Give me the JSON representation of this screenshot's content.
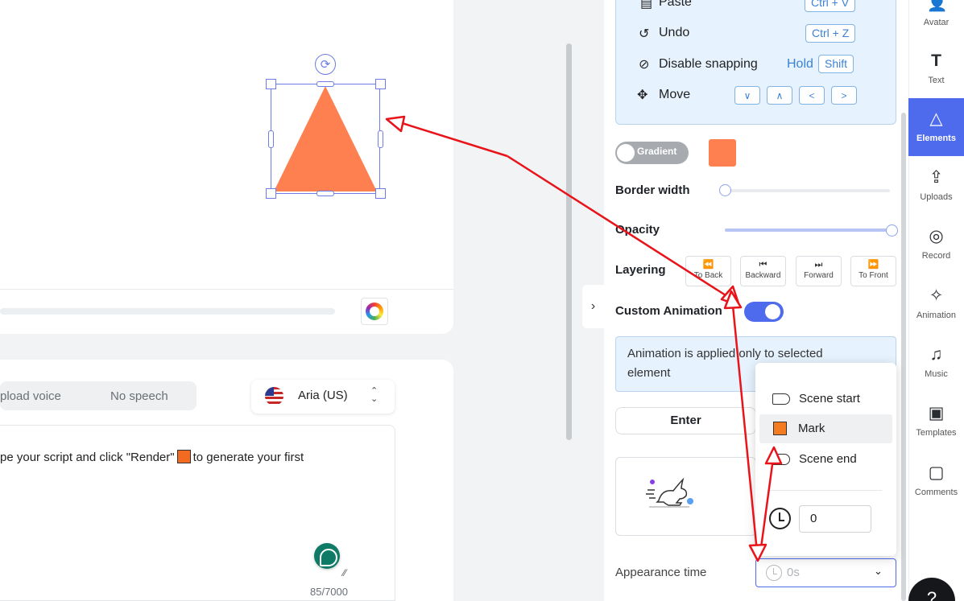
{
  "script": {
    "voice_tabs": [
      "pload voice",
      "No speech"
    ],
    "voice_name": "Aria (US)",
    "text_before": "pe your script and click \"Render\"",
    "text_after": "to generate your first",
    "char_count": "85/7000"
  },
  "shortcuts": {
    "paste": {
      "label": "Paste",
      "key": "Ctrl + V"
    },
    "undo": {
      "label": "Undo",
      "key": "Ctrl + Z"
    },
    "snapping": {
      "label": "Disable snapping",
      "hold": "Hold",
      "key": "Shift"
    },
    "move": {
      "label": "Move"
    }
  },
  "style": {
    "gradient_label": "Gradient",
    "fill_color": "#fe7f4f",
    "border_width_label": "Border width",
    "opacity_label": "Opacity",
    "layering_label": "Layering",
    "layering_buttons": [
      "To Back",
      "Backward",
      "Forward",
      "To Front"
    ]
  },
  "animation": {
    "custom_label": "Custom Animation",
    "info": "Animation is applied only to selected element",
    "enter_tab": "Enter",
    "appearance_label": "Appearance time",
    "appearance_value": "0s"
  },
  "menu": {
    "items": [
      "Scene start",
      "Mark",
      "Scene end"
    ],
    "time_value": "0"
  },
  "sidebar": {
    "items": [
      "Avatar",
      "Text",
      "Elements",
      "Uploads",
      "Record",
      "Animation",
      "Music",
      "Templates",
      "Comments"
    ],
    "active": "Elements",
    "help": "?"
  },
  "colors": {
    "accent": "#4f6bed",
    "shape": "#fe7f4f",
    "annotation_arrow": "#e8141a"
  }
}
